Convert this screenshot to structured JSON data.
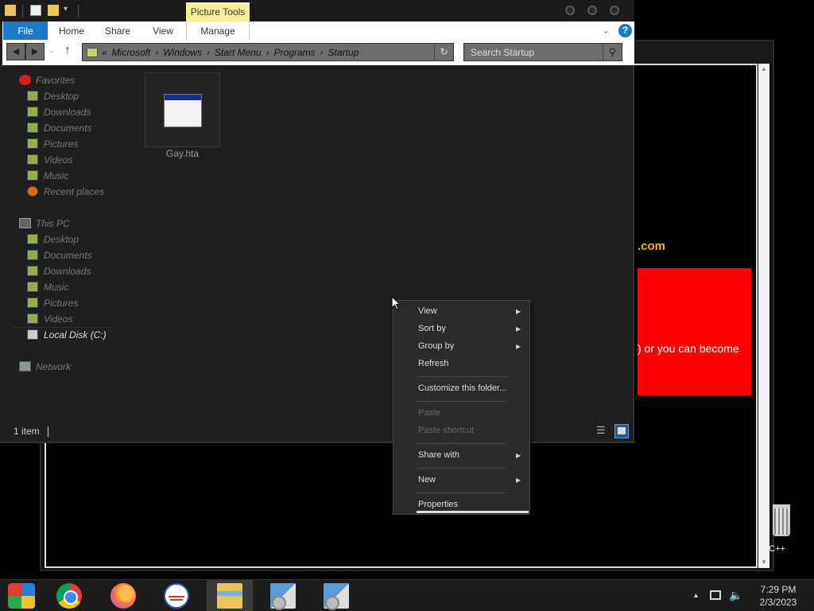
{
  "background_window": {
    "partial_text_domain": ".com",
    "partial_text_red": ") or you can become",
    "colors": {
      "red_box": "#ff0000",
      "domain_text": "#f5b400"
    }
  },
  "desktop": {
    "recycle_bin_label": "n C++"
  },
  "explorer": {
    "contextual_tab": "Picture Tools",
    "ribbon_tabs": [
      {
        "label": "File"
      },
      {
        "label": "Home"
      },
      {
        "label": "Share"
      },
      {
        "label": "View"
      },
      {
        "label": "Manage"
      }
    ],
    "address_path": [
      "«",
      "Microsoft",
      "›",
      "Windows",
      "›",
      "Start Menu",
      "›",
      "Programs",
      "›",
      "Startup"
    ],
    "search_placeholder": "Search Startup",
    "nav": {
      "favorites_label": "Favorites",
      "favorites": [
        "Desktop",
        "Downloads",
        "Documents",
        "Pictures",
        "Videos",
        "Music",
        "Recent places"
      ],
      "thispc_label": "This PC",
      "thispc": [
        "Desktop",
        "Documents",
        "Downloads",
        "Music",
        "Pictures",
        "Videos",
        "Local Disk (C:)"
      ],
      "network_label": "Network"
    },
    "files": [
      {
        "name": "Gay.hta",
        "icon": "hta-application-icon"
      }
    ],
    "status_text": "1 item"
  },
  "context_menu": {
    "items": [
      {
        "label": "View",
        "submenu": true,
        "disabled": false
      },
      {
        "label": "Sort by",
        "submenu": true,
        "disabled": false
      },
      {
        "label": "Group by",
        "submenu": true,
        "disabled": false
      },
      {
        "label": "Refresh",
        "submenu": false,
        "disabled": false
      },
      {
        "label": "Customize this folder...",
        "submenu": false,
        "disabled": false
      },
      {
        "label": "Paste",
        "submenu": false,
        "disabled": true
      },
      {
        "label": "Paste shortcut",
        "submenu": false,
        "disabled": true
      },
      {
        "label": "Share with",
        "submenu": true,
        "disabled": false
      },
      {
        "label": "New",
        "submenu": true,
        "disabled": false
      },
      {
        "label": "Properties",
        "submenu": false,
        "disabled": false
      }
    ]
  },
  "taskbar": {
    "apps": [
      "start-icon",
      "chrome-icon",
      "firefox-icon",
      "obama-logo-icon",
      "file-explorer-icon",
      "setup-icon",
      "setup-icon"
    ],
    "time": "7:29 PM",
    "date": "2/3/2023"
  }
}
